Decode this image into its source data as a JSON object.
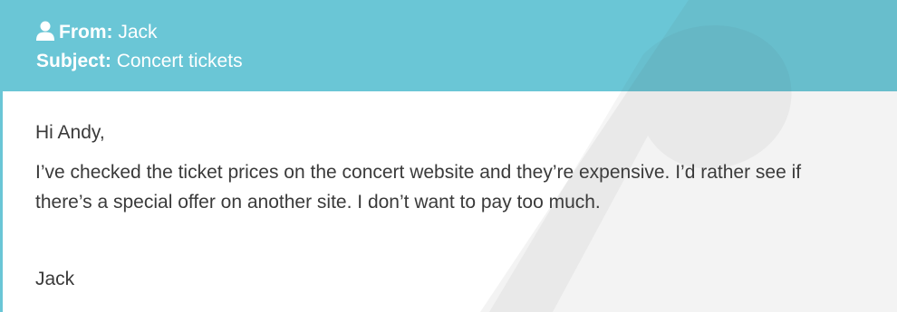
{
  "email": {
    "from_label": "From:",
    "from_value": "Jack",
    "subject_label": "Subject:",
    "subject_value": "Concert tickets",
    "greeting": "Hi Andy,",
    "message": "I’ve checked the ticket prices on the concert website and they’re expensive. I’d rather see if there’s a special offer on another site. I don’t want to pay too much.",
    "signoff": "Jack"
  },
  "colors": {
    "header_bg": "#6ac6d6",
    "header_text": "#ffffff",
    "body_text": "#3a3a3a"
  },
  "icons": {
    "sender": "person-icon"
  }
}
